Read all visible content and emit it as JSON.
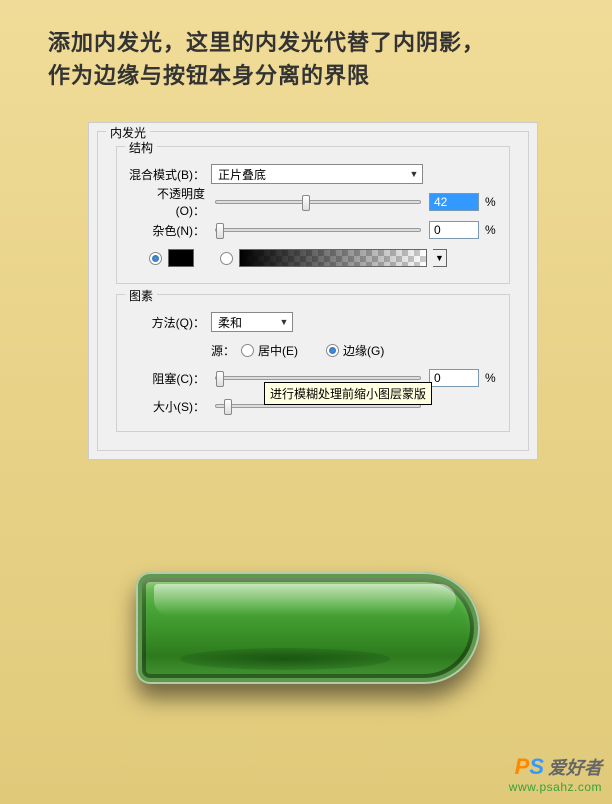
{
  "intro": {
    "line1": "添加内发光，这里的内发光代替了内阴影，",
    "line2": "作为边缘与按钮本身分离的界限"
  },
  "panel": {
    "title": "内发光",
    "structure": {
      "legend": "结构",
      "blendModeLabel": "混合模式(B)：",
      "blendModeValue": "正片叠底",
      "opacityLabel": "不透明度(O)：",
      "opacityValue": "42",
      "opacityUnit": "%",
      "noiseLabel": "杂色(N)：",
      "noiseValue": "0",
      "noiseUnit": "%"
    },
    "elements": {
      "legend": "图素",
      "methodLabel": "方法(Q)：",
      "methodValue": "柔和",
      "sourceLabel": "源：",
      "centerLabel": "居中(E)",
      "edgeLabel": "边缘(G)",
      "chokeLabel": "阻塞(C)：",
      "chokeValue": "0",
      "chokeUnit": "%",
      "sizeLabel": "大小(S)："
    },
    "tooltip": "进行模糊处理前缩小图层蒙版"
  },
  "watermark": {
    "p": "P",
    "s": "S",
    "cn": "爱好者",
    "url": "www.psahz.com"
  }
}
